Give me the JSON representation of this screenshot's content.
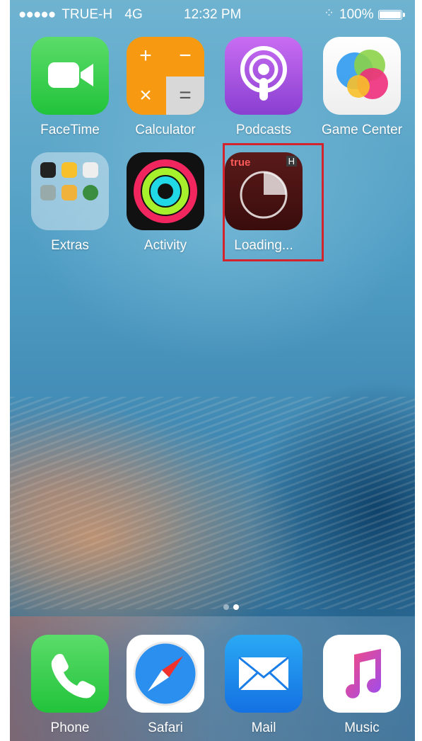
{
  "status_bar": {
    "signal_dots": "●●●●●",
    "carrier": "TRUE-H",
    "network": "4G",
    "time": "12:32 PM",
    "activity_indicator": "⁘",
    "battery_percent": "100%"
  },
  "home_apps": [
    {
      "label": "FaceTime",
      "icon": "facetime-icon"
    },
    {
      "label": "Calculator",
      "icon": "calculator-icon"
    },
    {
      "label": "Podcasts",
      "icon": "podcasts-icon"
    },
    {
      "label": "Game Center",
      "icon": "game-center-icon"
    },
    {
      "label": "Extras",
      "icon": "folder-icon"
    },
    {
      "label": "Activity",
      "icon": "activity-rings-icon"
    },
    {
      "label": "Loading...",
      "icon": "truemove-h-icon",
      "badge_text": "true",
      "badge_letter": "H"
    }
  ],
  "calculator_symbols": [
    "+",
    "−",
    "×",
    "="
  ],
  "page_indicator": {
    "pages": 2,
    "current": 2
  },
  "dock_apps": [
    {
      "label": "Phone",
      "icon": "phone-icon"
    },
    {
      "label": "Safari",
      "icon": "safari-compass-icon"
    },
    {
      "label": "Mail",
      "icon": "mail-envelope-icon"
    },
    {
      "label": "Music",
      "icon": "music-note-icon"
    }
  ],
  "colors": {
    "highlight_border": "#d3242d",
    "facetime_green": "#22c33b",
    "calculator_orange": "#f79a12",
    "podcasts_purple": "#8a3fd1",
    "mail_blue": "#1471e2"
  }
}
